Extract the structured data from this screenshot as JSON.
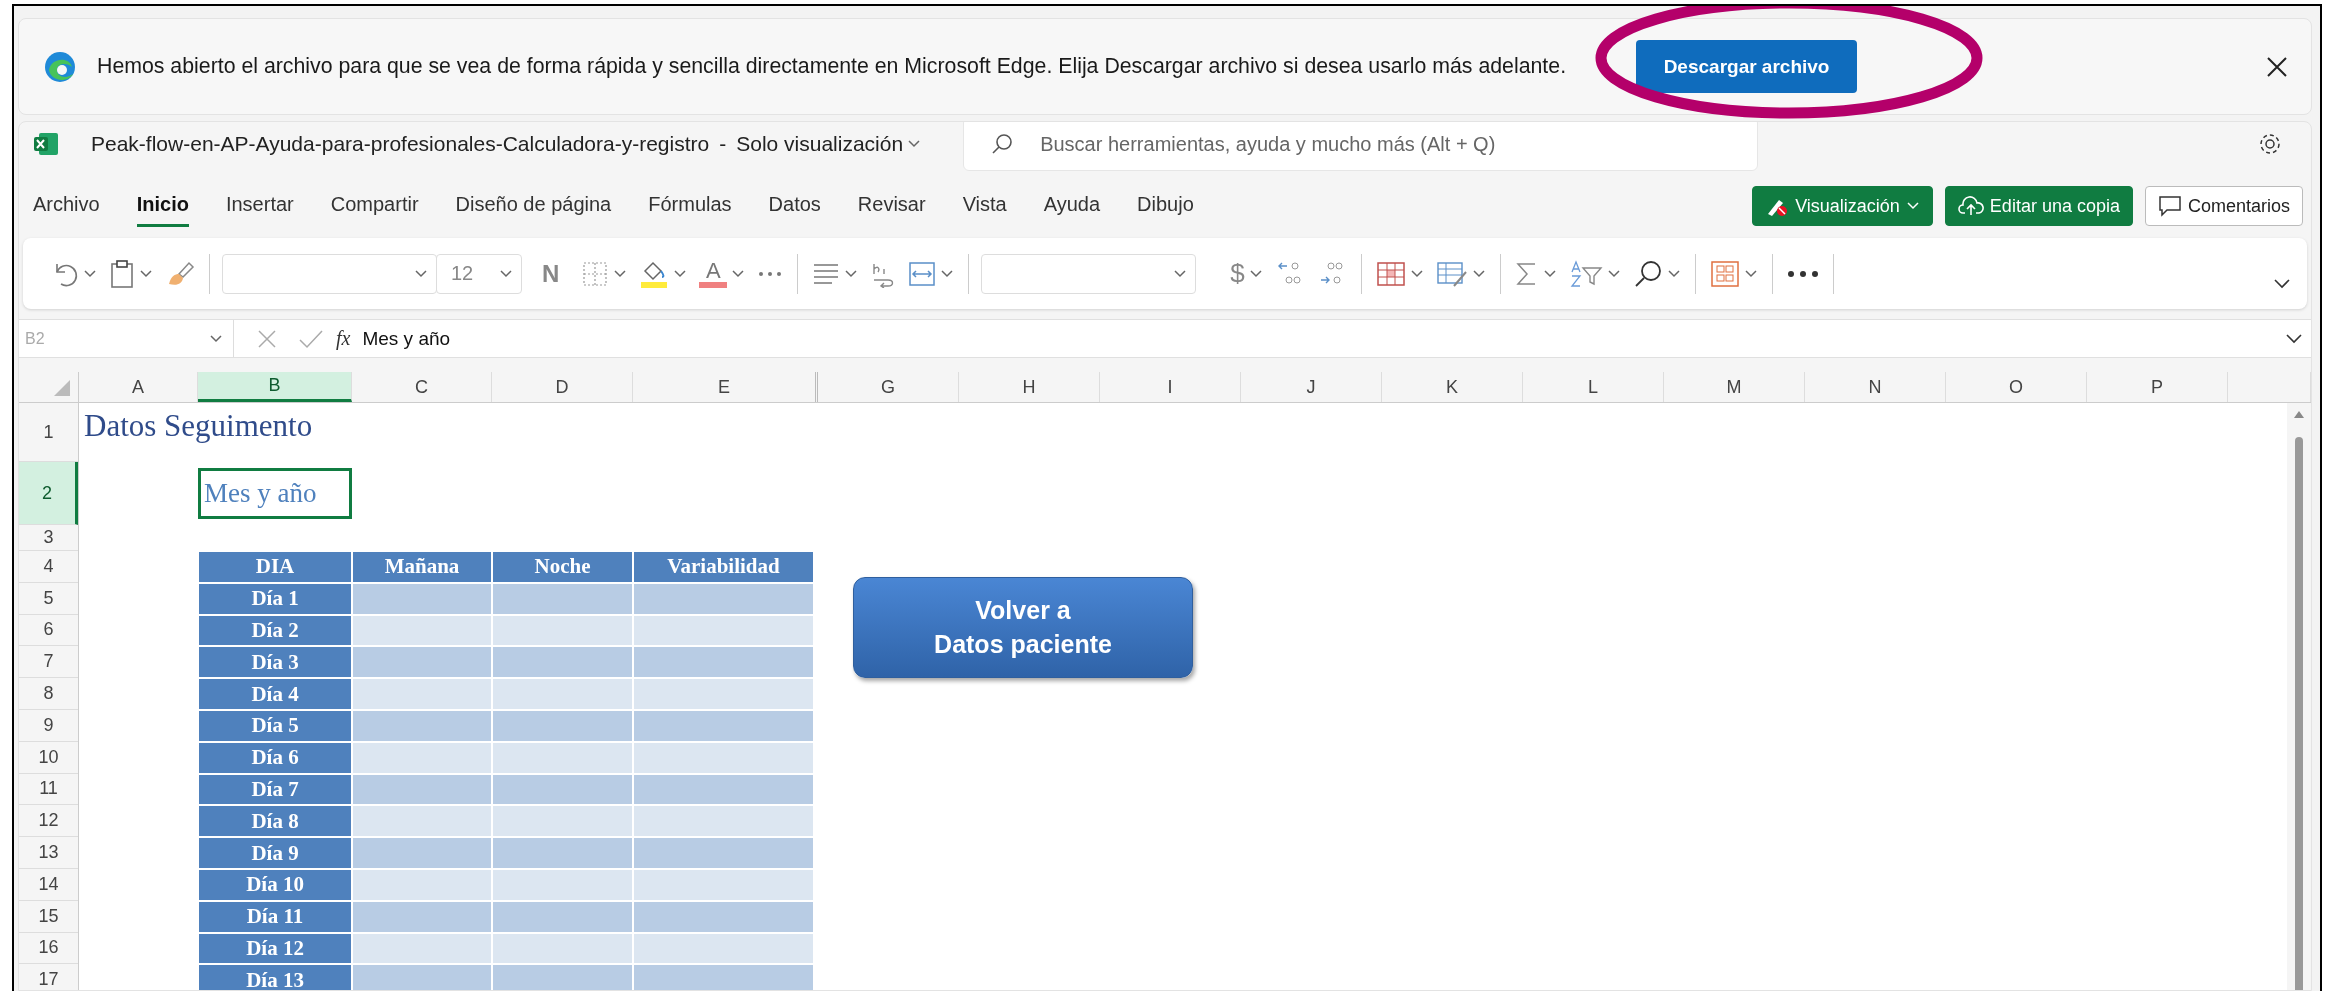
{
  "infobar": {
    "message": "Hemos abierto el archivo para que se vea de forma rápida y sencilla directamente en Microsoft Edge. Elija Descargar archivo si desea usarlo más adelante.",
    "button": "Descargar archivo",
    "highlighted": true
  },
  "header": {
    "file_name": "Peak-flow-en-AP-Ayuda-para-profesionales-Calculadora-y-registro",
    "separator": "-",
    "mode": "Solo visualización",
    "search": {
      "placeholder": "Buscar herramientas, ayuda y mucho más (Alt + Q)"
    }
  },
  "tabs": [
    {
      "label": "Archivo",
      "selected": false
    },
    {
      "label": "Inicio",
      "selected": true
    },
    {
      "label": "Insertar",
      "selected": false
    },
    {
      "label": "Compartir",
      "selected": false
    },
    {
      "label": "Diseño de página",
      "selected": false
    },
    {
      "label": "Fórmulas",
      "selected": false
    },
    {
      "label": "Datos",
      "selected": false
    },
    {
      "label": "Revisar",
      "selected": false
    },
    {
      "label": "Vista",
      "selected": false
    },
    {
      "label": "Ayuda",
      "selected": false
    },
    {
      "label": "Dibujo",
      "selected": false
    }
  ],
  "actions": [
    {
      "label": "Visualización",
      "kind": "mode"
    },
    {
      "label": "Editar una copia",
      "kind": "copy"
    },
    {
      "label": "Comentarios",
      "kind": "comments"
    }
  ],
  "toolbar": {
    "font_size": "12",
    "bold": "N",
    "font_color": "A",
    "currency": "$"
  },
  "formula_bar": {
    "name_box": "B2",
    "fx": "fx",
    "content": "Mes y año"
  },
  "columns": [
    {
      "label": "A",
      "selected": false
    },
    {
      "label": "B",
      "selected": true
    },
    {
      "label": "C",
      "selected": false
    },
    {
      "label": "D",
      "selected": false
    },
    {
      "label": "E",
      "selected": false
    },
    {
      "label": "G",
      "selected": false
    },
    {
      "label": "H",
      "selected": false
    },
    {
      "label": "I",
      "selected": false
    },
    {
      "label": "J",
      "selected": false
    },
    {
      "label": "K",
      "selected": false
    },
    {
      "label": "L",
      "selected": false
    },
    {
      "label": "M",
      "selected": false
    },
    {
      "label": "N",
      "selected": false
    },
    {
      "label": "O",
      "selected": false
    },
    {
      "label": "P",
      "selected": false
    }
  ],
  "rows": [
    {
      "label": "1",
      "selected": false
    },
    {
      "label": "2",
      "selected": true
    },
    {
      "label": "3",
      "selected": false
    },
    {
      "label": "4",
      "selected": false
    },
    {
      "label": "5",
      "selected": false
    },
    {
      "label": "6",
      "selected": false
    },
    {
      "label": "7",
      "selected": false
    },
    {
      "label": "8",
      "selected": false
    },
    {
      "label": "9",
      "selected": false
    },
    {
      "label": "10",
      "selected": false
    },
    {
      "label": "11",
      "selected": false
    },
    {
      "label": "12",
      "selected": false
    },
    {
      "label": "13",
      "selected": false
    },
    {
      "label": "14",
      "selected": false
    },
    {
      "label": "15",
      "selected": false
    },
    {
      "label": "16",
      "selected": false
    },
    {
      "label": "17",
      "selected": false
    }
  ],
  "sheet": {
    "title": "Datos Seguimento",
    "month_cell": {
      "text": "Mes y año",
      "selected": true
    },
    "headers": [
      "DIA",
      "Mañana",
      "Noche",
      "Variabilidad"
    ],
    "days": [
      "Día 1",
      "Día 2",
      "Día 3",
      "Día 4",
      "Día 5",
      "Día 6",
      "Día 7",
      "Día 8",
      "Día 9",
      "Día 10",
      "Día 11",
      "Día 12",
      "Día 13"
    ],
    "shape_button": "Volver a\nDatos paciente"
  }
}
